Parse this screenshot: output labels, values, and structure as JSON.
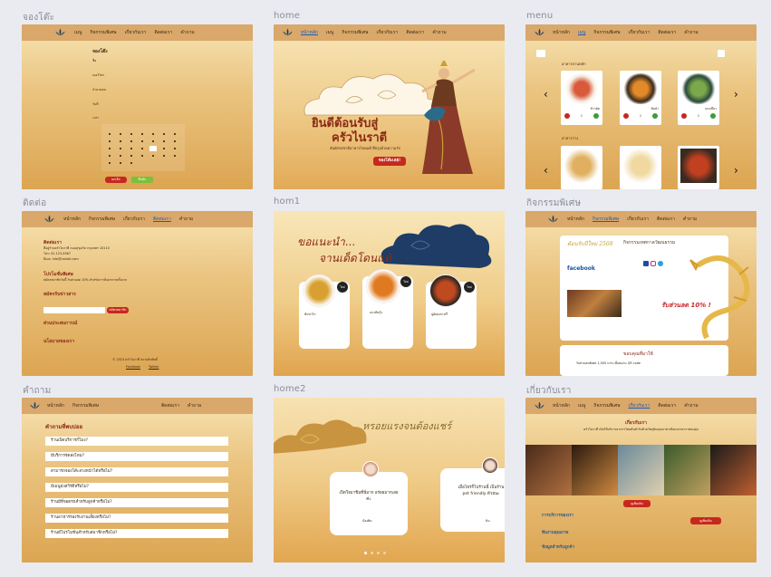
{
  "panels": {
    "booking": "จองโต๊ะ",
    "home": "home",
    "menu": "menu",
    "contact": "ติดต่อ",
    "hom1": "hom1",
    "activity": "กิจกรรมพิเศษ",
    "faq": "คำถาม",
    "home2": "home2",
    "about": "เกี่ยวกับเรา"
  },
  "nav": {
    "home": "หน้าหลัก",
    "menu": "เมนู",
    "activity": "กิจกรรมพิเศษ",
    "about": "เกี่ยวกับเรา",
    "contact": "ติดต่อเรา",
    "faq": "คำถาม"
  },
  "booking": {
    "title": "จองโต๊ะ",
    "fields": [
      "ชื่อ",
      "เบอร์โทร",
      "จำนวนคน",
      "วันที่",
      "เวลา"
    ],
    "cancel": "ยกเลิก",
    "confirm": "ยืนยัน"
  },
  "home": {
    "line1": "ยินดีต้อนรับสู่",
    "line2": "ครัวไนราตี",
    "sub": "สัมผัสรสชาติอาหารไทยแท้ ที่ปรุงด้วยความรัก",
    "cta": "จองโต๊ะเลย!"
  },
  "menu": {
    "section1": "อาหารจานหลัก",
    "section2": "อาหารว่าง",
    "items": [
      "ข้าวผัด",
      "ต้มยำ",
      "แกงเขียว"
    ],
    "qty": "1"
  },
  "contact": {
    "h1": "ติดต่อเรา",
    "address": "ที่อยู่ร้านครัวไนราตี ถนนสุขุมวิท กรุงเทพฯ 10110",
    "phone": "โทร: 02-123-4567",
    "email": "อีเมล: info@nairati.com",
    "h2": "โปรโมชั่นพิเศษ",
    "promo": "สมัครสมาชิกวันนี้ รับส่วนลด 10% สำหรับการสั่งอาหารครั้งแรก",
    "h3": "สมัครรับข่าวสาร",
    "sub_btn": "สมัครสมาชิก",
    "h4": "ส่วนประสบการณ์",
    "h5": "นโยบายของเรา",
    "footer": "© 2023 ครัวไนราตี สงวนลิขสิทธิ์",
    "fb": "Facebook",
    "tw": "Twitter"
  },
  "hom1": {
    "title1": "ขอแนะนำ...",
    "title2": "จานเด็ดโดนแท้",
    "cards": [
      "ต้มข่าไก่",
      "แกงส้มกุ้ง",
      "ปูผัดผงกะหรี่"
    ],
    "badge": "ใหม่"
  },
  "activity": {
    "event": "กิจกรรมเทศกาลวัฒนธรรม",
    "year": "ต้อนรับปีใหม่ 2568",
    "fb": "facebook",
    "discount": "รับส่วนลด 10% !",
    "box_title": "ขอบคุณที่มาใช้",
    "box_text": "รับส่วนลดพิเศษ 1,000 บาท เมื่อสแกน QR code"
  },
  "faq": {
    "title": "คำถามที่พบบ่อย",
    "questions": [
      "ร้านเปิดบริการกี่โมง?",
      "มีบริการจัดส่งไหม?",
      "สามารถจองโต๊ะล่วงหน้าได้หรือไม่?",
      "มีเมนูมังสวิรัติหรือไม่?",
      "ร้านมีที่จอดรถสำหรับลูกค้าหรือไม่?",
      "ร้านอาหารรองรับงานเลี้ยงหรือไม่?",
      "ร้านมีโปรโมชั่นสำหรับสมาชิกหรือไม่?"
    ]
  },
  "home2": {
    "title": "หรอยแรงจนต้องแชร์",
    "review1": "เปิดใจมาชิมที่นี่มาก อร่อยมากเลยค่ะ",
    "name1": "น้องพิม",
    "review2": "เมื่อไหร่ก็ไปร้านนี้ เป็นร้าน pet friendly ด้วยนะ",
    "name2": "มิน"
  },
  "about": {
    "title": "เกี่ยวกับเรา",
    "text": "ครัวไนราตี เปิดให้บริการอาหารไทยต้นตำรับด้วยวัตถุดิบคุณภาพ พร้อมบรรยากาศอบอุ่น",
    "btn1": "ดูเพิ่มเติม",
    "h1": "การบริการของเรา",
    "h2": "ทีมงานคุณภาพ",
    "h3": "ข้อมูลสำหรับลูกค้า"
  }
}
